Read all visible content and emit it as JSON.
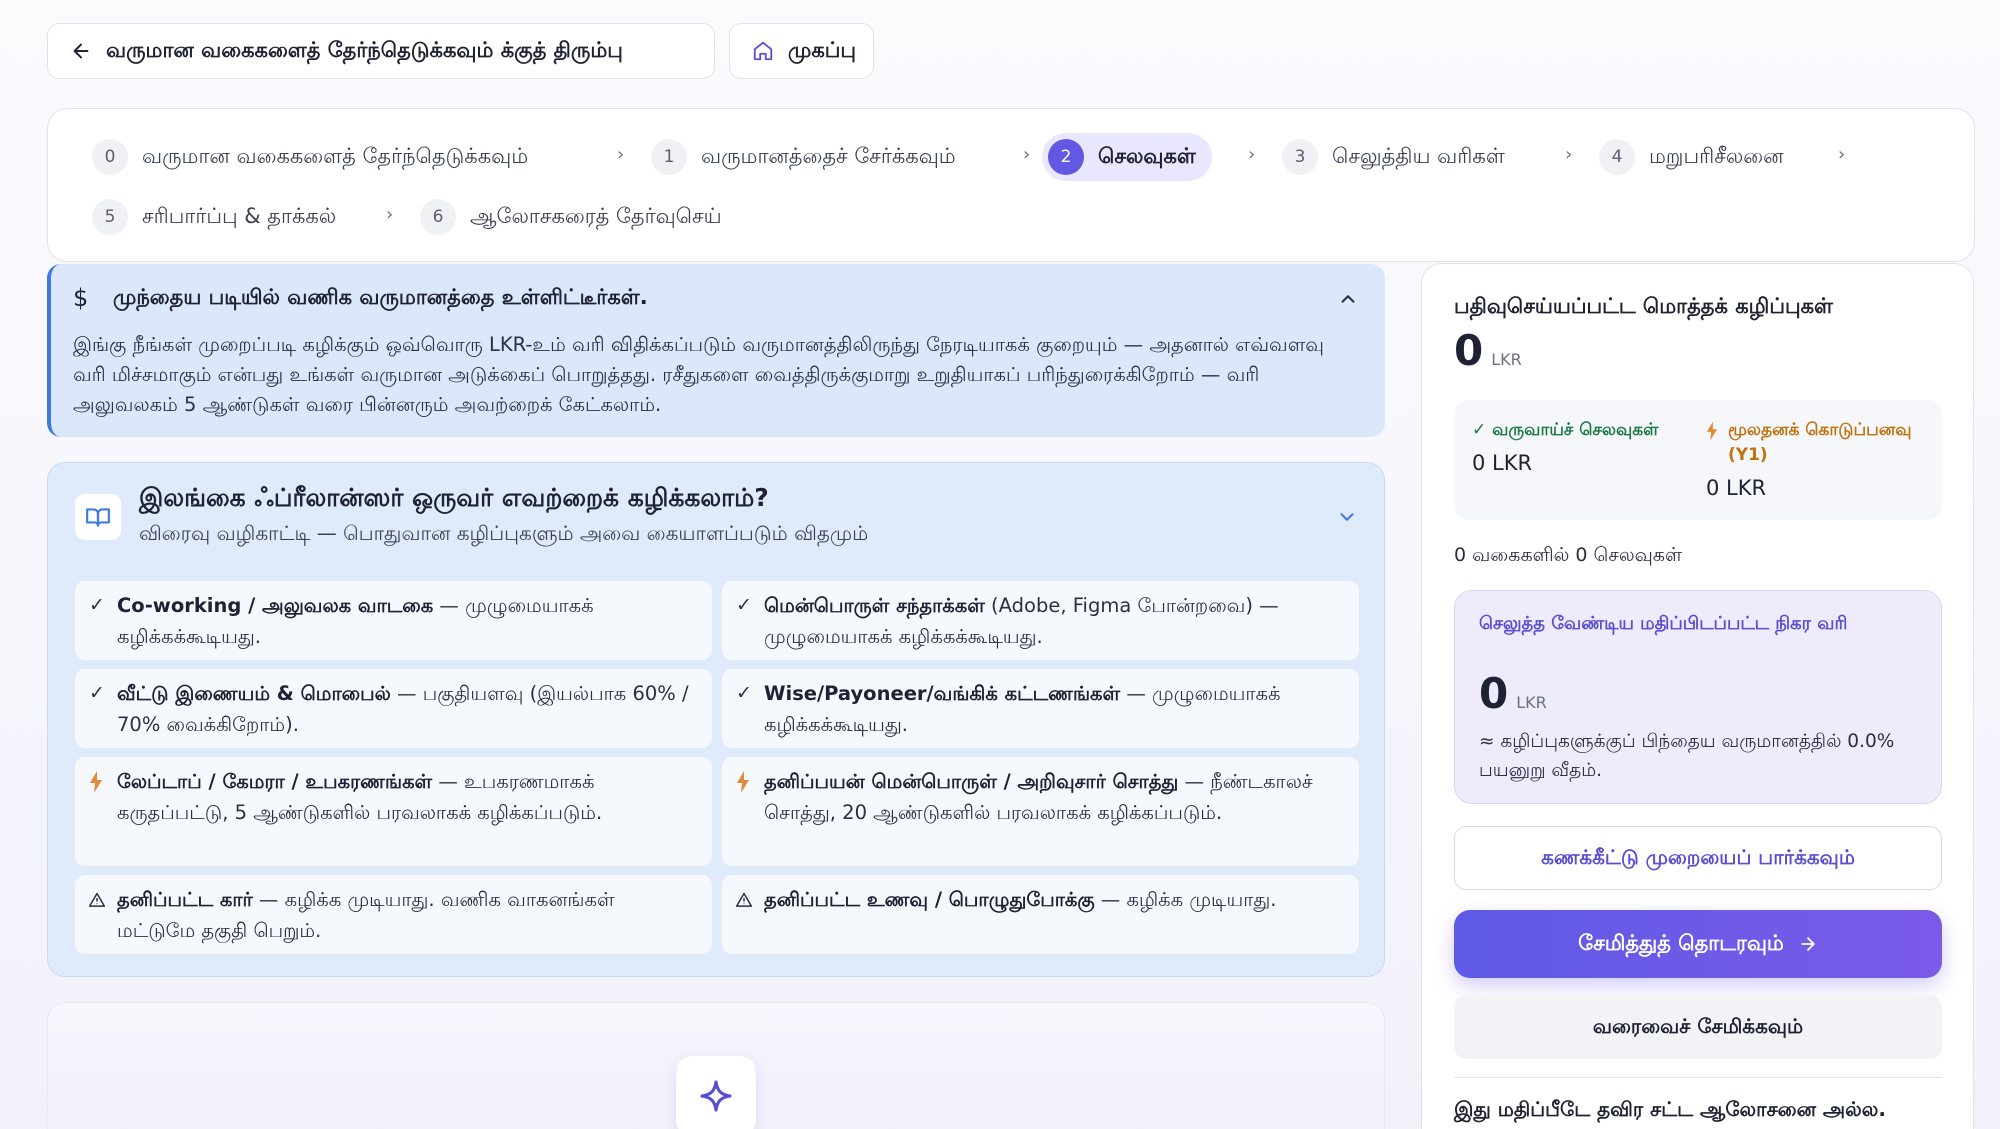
{
  "nav": {
    "back_label": "வருமான வகைகளைத் தேர்ந்தெடுக்கவும் க்குத் திரும்பு",
    "home_label": "முகப்பு"
  },
  "stepper": {
    "steps": [
      {
        "num": "0",
        "label": "வருமான வகைகளைத் தேர்ந்தெடுக்கவும்"
      },
      {
        "num": "1",
        "label": "வருமானத்தைச் சேர்க்கவும்"
      },
      {
        "num": "2",
        "label": "செலவுகள்"
      },
      {
        "num": "3",
        "label": "செலுத்திய வரிகள்"
      },
      {
        "num": "4",
        "label": "மறுபரிசீலனை"
      },
      {
        "num": "5",
        "label": "சரிபார்ப்பு & தாக்கல்"
      },
      {
        "num": "6",
        "label": "ஆலோசகரைத் தேர்வுசெய்"
      }
    ],
    "active_index": 2,
    "separator": "›"
  },
  "notice": {
    "icon": "$",
    "title": "முந்தைய படியில் வணிக வருமானத்தை உள்ளிட்டீர்கள்.",
    "body": "இங்கு நீங்கள் முறைப்படி கழிக்கும் ஒவ்வொரு LKR-உம் வரி விதிக்கப்படும் வருமானத்திலிருந்து நேரடியாகக் குறையும் — அதனால் எவ்வளவு வரி மிச்சமாகும் என்பது உங்கள் வருமான அடுக்கைப் பொறுத்தது. ரசீதுகளை வைத்திருக்குமாறு உறுதியாகப் பரிந்துரைக்கிறோம் — வரி அலுவலகம் 5 ஆண்டுகள் வரை பின்னரும் அவற்றைக் கேட்கலாம்."
  },
  "guide": {
    "title": "இலங்கை ஃப்ரீலான்ஸர் ஒருவர் எவற்றைக் கழிக்கலாம்?",
    "subtitle": "விரைவு வழிகாட்டி — பொதுவான கழிப்புகளும் அவை கையாளப்படும் விதமும்",
    "items": [
      {
        "kind": "check",
        "title": "Co-working / அலுவலக வாடகை",
        "text": " — முழுமையாகக் கழிக்கக்கூடியது."
      },
      {
        "kind": "check",
        "title": "மென்பொருள் சந்தாக்கள்",
        "text": " (Adobe, Figma போன்றவை) — முழுமையாகக் கழிக்கக்கூடியது."
      },
      {
        "kind": "check",
        "title": "வீட்டு இணையம் & மொபைல்",
        "text": " — பகுதியளவு (இயல்பாக 60% / 70% வைக்கிறோம்)."
      },
      {
        "kind": "check",
        "title": "Wise/Payoneer/வங்கிக் கட்டணங்கள்",
        "text": " — முழுமையாகக் கழிக்கக்கூடியது."
      },
      {
        "kind": "bolt",
        "title": "லேப்டாப் / கேமரா / உபகரணங்கள்",
        "text": " — உபகரணமாகக் கருதப்பட்டு, 5 ஆண்டுகளில் பரவலாகக் கழிக்கப்படும்."
      },
      {
        "kind": "bolt",
        "title": "தனிப்பயன் மென்பொருள் / அறிவுசார் சொத்து",
        "text": " — நீண்டகாலச் சொத்து, 20 ஆண்டுகளில் பரவலாகக் கழிக்கப்படும்."
      },
      {
        "kind": "warn",
        "title": "தனிப்பட்ட கார்",
        "text": " — கழிக்க முடியாது. வணிக வாகனங்கள் மட்டுமே தகுதி பெறும்."
      },
      {
        "kind": "warn",
        "title": "தனிப்பட்ட உணவு / பொழுதுபோக்கு",
        "text": " — கழிக்க முடியாது."
      }
    ]
  },
  "sidebar": {
    "total_label": "பதிவுசெய்யப்பட்ட மொத்தக் கழிப்புகள்",
    "total_value": "0",
    "currency": "LKR",
    "revenue_label": "✓ வருவாய்ச் செலவுகள்",
    "revenue_value": "0 LKR",
    "capital_label": "மூலதனக் கொடுப்பனவு (Y1)",
    "capital_value": "0 LKR",
    "count_text": "0 வகைகளில் 0 செலவுகள்",
    "tax_label": "செலுத்த வேண்டிய மதிப்பிடப்பட்ட நிகர வரி",
    "tax_value": "0",
    "tax_note": "≈ கழிப்புகளுக்குப் பிந்தைய வருமானத்தில் 0.0% பயனுறு வீதம்.",
    "calc_button": "கணக்கீட்டு முறையைப் பார்க்கவும்",
    "save_button": "சேமித்துத் தொடரவும்",
    "draft_button": "வரைவைச் சேமிக்கவும்",
    "disclaimer": "இது மதிப்பீடே தவிர சட்ட ஆலோசனை அல்ல."
  },
  "colors": {
    "accent": "#6358e4",
    "notice_bg": "#dbe8fb",
    "check": "#1f7a4a",
    "capital": "#c0740f"
  }
}
